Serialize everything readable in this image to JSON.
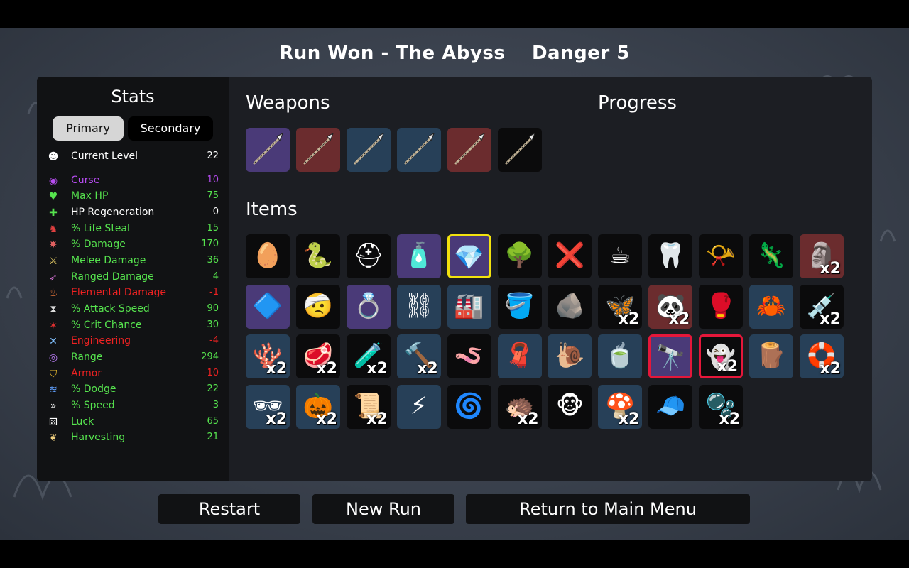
{
  "header": {
    "run_result": "Run Won - The Abyss",
    "danger": "Danger 5"
  },
  "stats": {
    "title": "Stats",
    "tabs": {
      "primary": "Primary",
      "secondary": "Secondary"
    },
    "rows": [
      {
        "label": "Current Level",
        "value": "22",
        "color": "#ffffff",
        "icon": "level-icon"
      },
      {
        "label": "Curse",
        "value": "10",
        "color": "#b64cf0",
        "icon": "curse-icon"
      },
      {
        "label": "Max HP",
        "value": "75",
        "color": "#56e34e",
        "icon": "heart-icon"
      },
      {
        "label": "HP Regeneration",
        "value": "0",
        "color": "#ffffff",
        "icon": "regen-icon"
      },
      {
        "label": "% Life Steal",
        "value": "15",
        "color": "#56e34e",
        "icon": "life-steal-icon"
      },
      {
        "label": "% Damage",
        "value": "170",
        "color": "#56e34e",
        "icon": "damage-icon"
      },
      {
        "label": "Melee Damage",
        "value": "36",
        "color": "#56e34e",
        "icon": "melee-icon"
      },
      {
        "label": "Ranged Damage",
        "value": "4",
        "color": "#56e34e",
        "icon": "ranged-icon"
      },
      {
        "label": "Elemental Damage",
        "value": "-1",
        "color": "#ee2222",
        "icon": "fire-icon"
      },
      {
        "label": "% Attack Speed",
        "value": "90",
        "color": "#56e34e",
        "icon": "hourglass-icon"
      },
      {
        "label": "% Crit Chance",
        "value": "30",
        "color": "#56e34e",
        "icon": "crit-icon"
      },
      {
        "label": "Engineering",
        "value": "-4",
        "color": "#ee2222",
        "icon": "wrench-icon"
      },
      {
        "label": "Range",
        "value": "294",
        "color": "#56e34e",
        "icon": "range-icon"
      },
      {
        "label": "Armor",
        "value": "-10",
        "color": "#ee2222",
        "icon": "shield-icon"
      },
      {
        "label": "% Dodge",
        "value": "22",
        "color": "#56e34e",
        "icon": "dodge-icon"
      },
      {
        "label": "% Speed",
        "value": "3",
        "color": "#56e34e",
        "icon": "boot-icon"
      },
      {
        "label": "Luck",
        "value": "65",
        "color": "#56e34e",
        "icon": "dice-icon"
      },
      {
        "label": "Harvesting",
        "value": "21",
        "color": "#56e34e",
        "icon": "wheat-icon"
      }
    ]
  },
  "weapons": {
    "title": "Weapons",
    "slots": [
      {
        "tier": "purple",
        "icon": "spear-icon"
      },
      {
        "tier": "red",
        "icon": "spear-icon"
      },
      {
        "tier": "blue",
        "icon": "spear-icon"
      },
      {
        "tier": "blue",
        "icon": "spear-icon"
      },
      {
        "tier": "red",
        "icon": "spear-icon"
      },
      {
        "tier": "black",
        "icon": "spear-icon"
      }
    ]
  },
  "progress": {
    "title": "Progress"
  },
  "items": {
    "title": "Items",
    "slots": [
      {
        "tier": "black",
        "icon": "egg-icon",
        "glyph": "🥚",
        "count": ""
      },
      {
        "tier": "black",
        "icon": "snake-icon",
        "glyph": "🐍",
        "count": ""
      },
      {
        "tier": "black",
        "icon": "helmet-icon",
        "glyph": "⛑",
        "count": ""
      },
      {
        "tier": "purple",
        "icon": "bottle-icon",
        "glyph": "🧴",
        "count": ""
      },
      {
        "tier": "purple",
        "icon": "crystal-icon",
        "glyph": "💎",
        "count": "",
        "highlight": "yellow"
      },
      {
        "tier": "black",
        "icon": "tree-icon",
        "glyph": "🌳",
        "count": ""
      },
      {
        "tier": "black",
        "icon": "no-target-icon",
        "glyph": "❌",
        "count": ""
      },
      {
        "tier": "black",
        "icon": "coffee-icon",
        "glyph": "☕",
        "count": ""
      },
      {
        "tier": "black",
        "icon": "tooth-icon",
        "glyph": "🦷",
        "count": ""
      },
      {
        "tier": "black",
        "icon": "whistle-icon",
        "glyph": "📯",
        "count": ""
      },
      {
        "tier": "black",
        "icon": "lizard-icon",
        "glyph": "🦎",
        "count": ""
      },
      {
        "tier": "red",
        "icon": "face-icon",
        "glyph": "🗿",
        "count": "x2"
      },
      {
        "tier": "purple",
        "icon": "triangle-icon",
        "glyph": "🔷",
        "count": ""
      },
      {
        "tier": "black",
        "icon": "bandage-icon",
        "glyph": "🤕",
        "count": ""
      },
      {
        "tier": "purple",
        "icon": "ring-icon",
        "glyph": "💍",
        "count": ""
      },
      {
        "tier": "blue",
        "icon": "bracelet-icon",
        "glyph": "⛓",
        "count": ""
      },
      {
        "tier": "blue",
        "icon": "machine-icon",
        "glyph": "🏭",
        "count": ""
      },
      {
        "tier": "black",
        "icon": "bucket-icon",
        "glyph": "🪣",
        "count": ""
      },
      {
        "tier": "black",
        "icon": "rock-icon",
        "glyph": "🪨",
        "count": ""
      },
      {
        "tier": "black",
        "icon": "fly-icon",
        "glyph": "🦋",
        "count": "x2"
      },
      {
        "tier": "red",
        "icon": "panda-icon",
        "glyph": "🐼",
        "count": "x2"
      },
      {
        "tier": "black",
        "icon": "glove-icon",
        "glyph": "🥊",
        "count": ""
      },
      {
        "tier": "blue",
        "icon": "crab-icon",
        "glyph": "🦀",
        "count": ""
      },
      {
        "tier": "black",
        "icon": "syringe-icon",
        "glyph": "💉",
        "count": "x2"
      },
      {
        "tier": "blue",
        "icon": "coral-icon",
        "glyph": "🪸",
        "count": "x2"
      },
      {
        "tier": "black",
        "icon": "flesh-icon",
        "glyph": "🥩",
        "count": "x2"
      },
      {
        "tier": "black",
        "icon": "cauldron-icon",
        "glyph": "🧪",
        "count": "x2"
      },
      {
        "tier": "blue",
        "icon": "mace-icon",
        "glyph": "🔨",
        "count": "x2"
      },
      {
        "tier": "black",
        "icon": "worm-icon",
        "glyph": "🪱",
        "count": ""
      },
      {
        "tier": "blue",
        "icon": "cape-icon",
        "glyph": "🧣",
        "count": ""
      },
      {
        "tier": "blue",
        "icon": "snail-icon",
        "glyph": "🐌",
        "count": ""
      },
      {
        "tier": "blue",
        "icon": "tea-icon",
        "glyph": "🍵",
        "count": ""
      },
      {
        "tier": "purple",
        "icon": "cannon-icon",
        "glyph": "🔭",
        "count": "",
        "highlight": "red"
      },
      {
        "tier": "black",
        "icon": "ghost-statue-icon",
        "glyph": "👻",
        "count": "x2",
        "highlight": "red"
      },
      {
        "tier": "blue",
        "icon": "plank-icon",
        "glyph": "🪵",
        "count": ""
      },
      {
        "tier": "blue",
        "icon": "lifebuoy-icon",
        "glyph": "🛟",
        "count": "x2"
      },
      {
        "tier": "blue",
        "icon": "mask-icon",
        "glyph": "🕶",
        "count": "x2"
      },
      {
        "tier": "blue",
        "icon": "pumpkin-icon",
        "glyph": "🎃",
        "count": "x2"
      },
      {
        "tier": "black",
        "icon": "scroll-icon",
        "glyph": "📜",
        "count": "x2"
      },
      {
        "tier": "blue",
        "icon": "claw-icon",
        "glyph": "⚡",
        "count": ""
      },
      {
        "tier": "black",
        "icon": "alien-icon",
        "glyph": "🌀",
        "count": ""
      },
      {
        "tier": "black",
        "icon": "hedgehog-icon",
        "glyph": "🦔",
        "count": "x2"
      },
      {
        "tier": "black",
        "icon": "monkey-icon",
        "glyph": "🐵",
        "count": ""
      },
      {
        "tier": "blue",
        "icon": "mushroom-icon",
        "glyph": "🍄",
        "count": "x2"
      },
      {
        "tier": "black",
        "icon": "propeller-hat-icon",
        "glyph": "🧢",
        "count": ""
      },
      {
        "tier": "black",
        "icon": "bubbles-icon",
        "glyph": "🫧",
        "count": "x2"
      }
    ]
  },
  "buttons": {
    "restart": "Restart",
    "new_run": "New Run",
    "main_menu": "Return to Main Menu"
  }
}
